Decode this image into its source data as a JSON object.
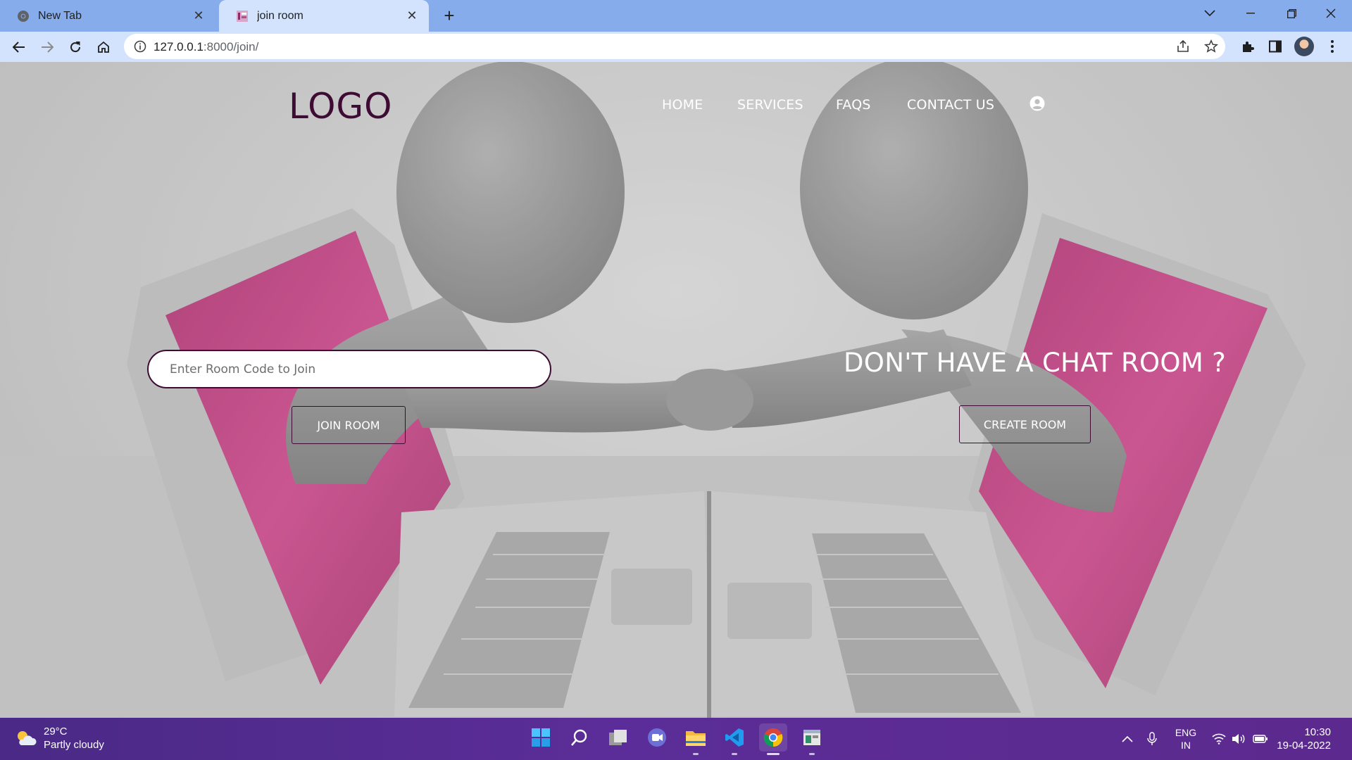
{
  "browser": {
    "tabs": [
      {
        "title": "New Tab",
        "active": false
      },
      {
        "title": "join room",
        "active": true
      }
    ],
    "url_host": "127.0.0.1",
    "url_path": ":8000/join/"
  },
  "site": {
    "logo": "LOGO",
    "nav": [
      "HOME",
      "SERVICES",
      "FAQS",
      "CONTACT US"
    ],
    "user_icon": "user-circle-icon"
  },
  "join": {
    "placeholder": "Enter Room Code to Join",
    "button_label": "JOIN ROOM"
  },
  "create": {
    "headline": "DON'T HAVE A CHAT ROOM ?",
    "button_label": "CREATE ROOM"
  },
  "taskbar": {
    "weather_temp": "29°C",
    "weather_desc": "Partly cloudy",
    "lang_primary": "ENG",
    "lang_secondary": "IN",
    "time": "10:30",
    "date": "19-04-2022",
    "apps": [
      "start-icon",
      "search-icon",
      "task-view-icon",
      "teams-chat-icon",
      "file-explorer-icon",
      "vscode-icon",
      "chrome-icon",
      "app-icon"
    ]
  },
  "colors": {
    "accent": "#3d0b33",
    "tab_bar": "#86acec",
    "toolbar": "#d3e3fd",
    "taskbar": "#5b2d98",
    "screen_pink": "#c42a77"
  }
}
